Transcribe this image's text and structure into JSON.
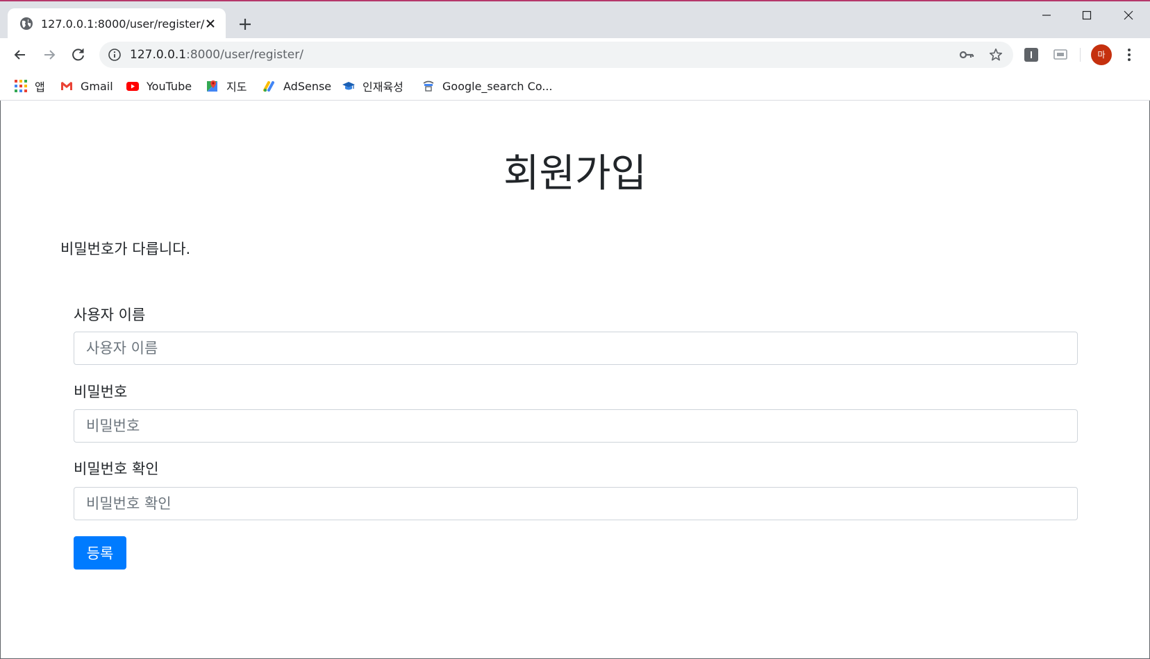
{
  "browser": {
    "tab": {
      "title": "127.0.0.1:8000/user/register/"
    },
    "address": {
      "host": "127.0.0.1",
      "path": ":8000/user/register/"
    },
    "profile_initial": "마",
    "accent_color": "#c5300e"
  },
  "bookmarks": [
    {
      "label": "앱",
      "icon": "apps-grid-icon"
    },
    {
      "label": "Gmail",
      "icon": "gmail-icon"
    },
    {
      "label": "YouTube",
      "icon": "youtube-icon"
    },
    {
      "label": "지도",
      "icon": "maps-icon"
    },
    {
      "label": "AdSense",
      "icon": "adsense-icon"
    },
    {
      "label": "인재육성",
      "icon": "graduation-cap-icon"
    },
    {
      "label": "Google_search Co...",
      "icon": "site-icon"
    }
  ],
  "page": {
    "title": "회원가입",
    "error_message": "비밀번호가 다릅니다.",
    "form": {
      "username": {
        "label": "사용자 이름",
        "placeholder": "사용자 이름",
        "value": ""
      },
      "password": {
        "label": "비밀번호",
        "placeholder": "비밀번호",
        "value": ""
      },
      "password_confirm": {
        "label": "비밀번호 확인",
        "placeholder": "비밀번호 확인",
        "value": ""
      },
      "submit_label": "등록"
    },
    "button_color": "#007bff"
  }
}
